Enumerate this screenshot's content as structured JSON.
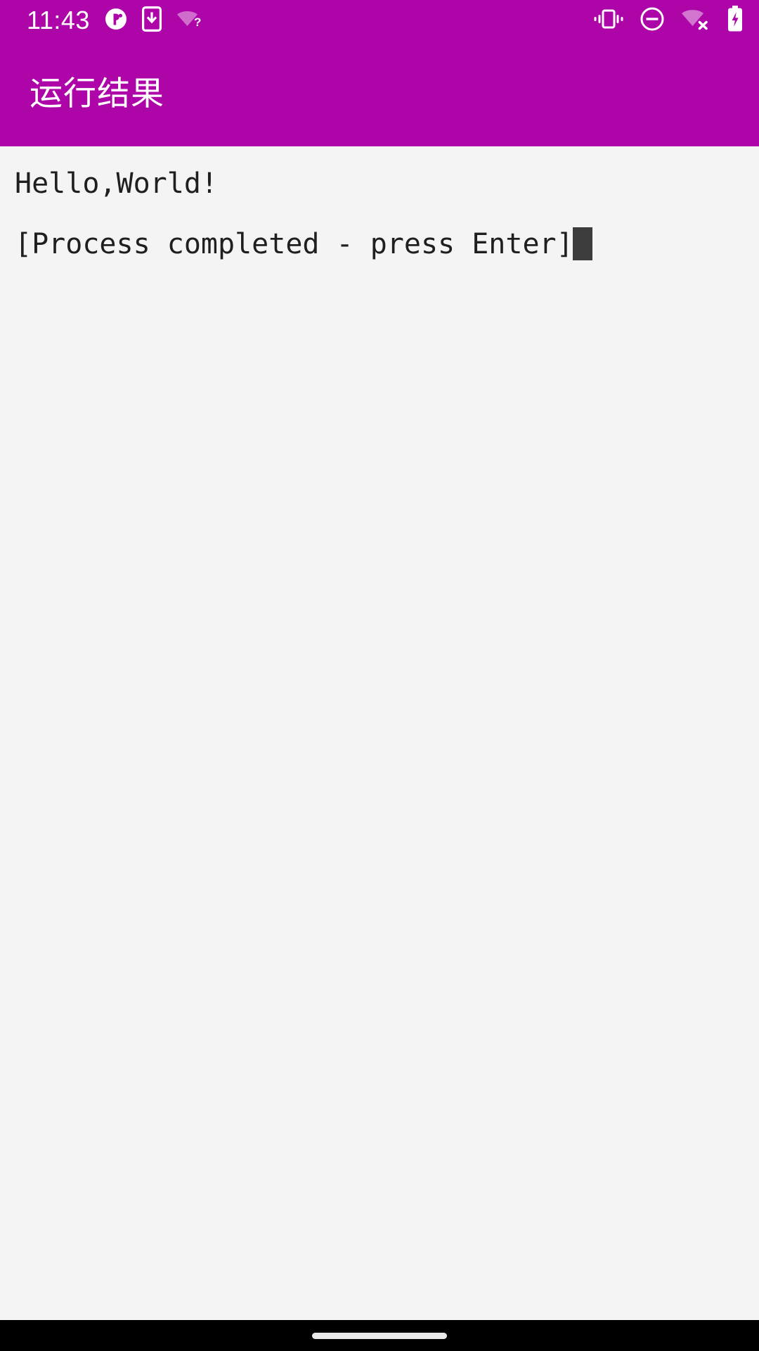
{
  "statusbar": {
    "time": "11:43",
    "left_icons": [
      {
        "name": "app-notification-icon",
        "label": "notification"
      },
      {
        "name": "phone-download-icon",
        "label": "download to device"
      },
      {
        "name": "wifi-unknown-icon",
        "label": "wifi unknown"
      }
    ],
    "right_icons": [
      {
        "name": "vibrate-icon",
        "label": "vibrate"
      },
      {
        "name": "do-not-disturb-icon",
        "label": "do not disturb"
      },
      {
        "name": "wifi-off-icon",
        "label": "wifi disconnected"
      },
      {
        "name": "battery-charging-icon",
        "label": "battery charging"
      }
    ]
  },
  "appbar": {
    "title": "运行结果",
    "background_color": "#ae05a8",
    "title_color": "#ffffff"
  },
  "console": {
    "background_color": "#f4f4f4",
    "text_color": "#1f1f1f",
    "cursor_color": "#3d3d3d",
    "lines": [
      {
        "text": "Hello,World!",
        "cursor": false
      },
      {
        "text": "[Process completed - press Enter]",
        "cursor": true
      }
    ]
  },
  "navbar": {
    "background_color": "#000000",
    "pill_color": "#e9e9e9"
  }
}
